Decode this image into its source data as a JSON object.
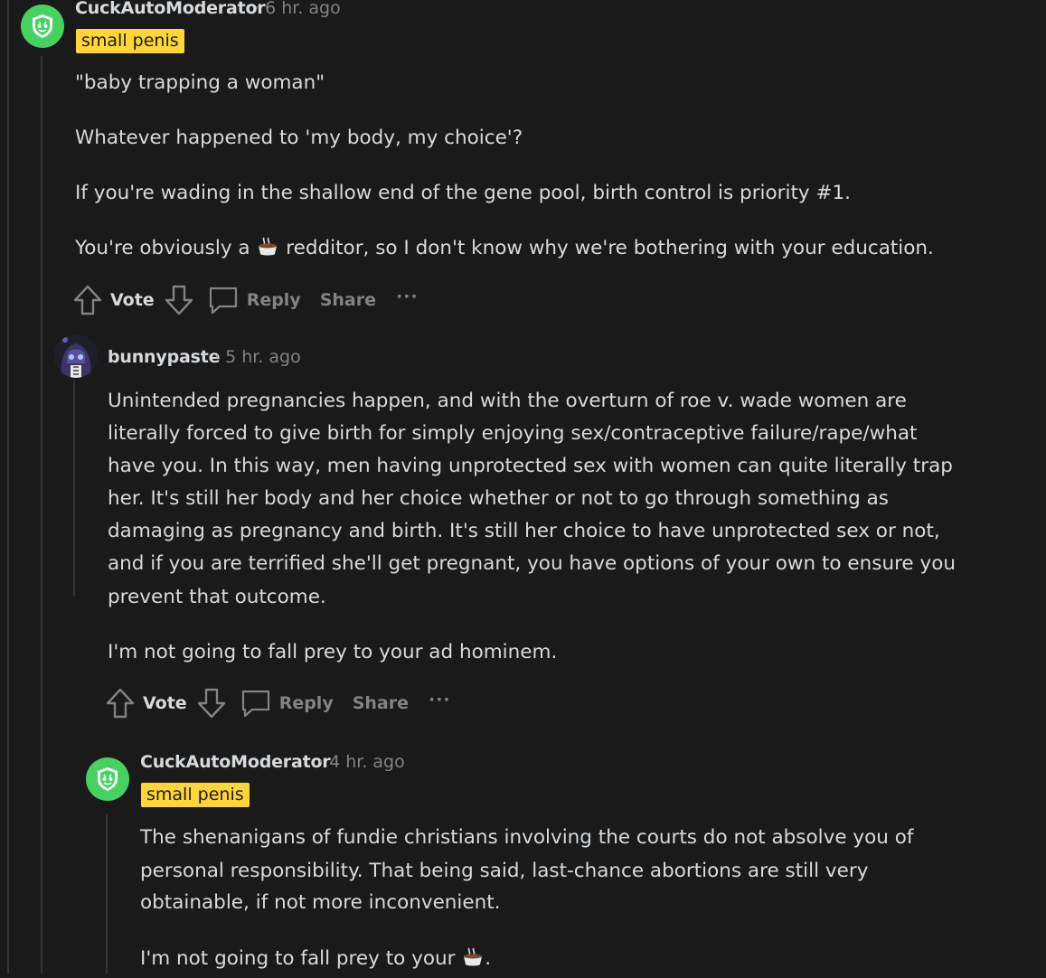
{
  "comments": [
    {
      "author": "CuckAutoModerator",
      "time": "· 6 hr. ago",
      "flair": "small penis",
      "paragraphs": [
        "\"baby trapping a woman\"",
        "Whatever happened to 'my body, my choice'?",
        "If you're wading in the shallow end of the gene pool, birth control is priority #1."
      ],
      "last_pre": "You're obviously a ",
      "last_post": " redditor, so I don't know why we're bothering with your education."
    },
    {
      "author": "bunnypaste",
      "time": "· 5 hr. ago",
      "paragraph_lines": [
        "Unintended pregnancies happen, and with the overturn of roe v. wade women are",
        "literally forced to give birth for simply enjoying sex/contraceptive failure/rape/what",
        "have you. In this way, men having unprotected sex with women can quite literally trap",
        "her. It's still her body and her choice whether or not to go through something as",
        "damaging as pregnancy and birth. It's still her choice to have unprotected sex or not,",
        "and if you are terrified she'll get pregnant, you have options of your own to ensure you",
        "prevent that outcome."
      ],
      "paragraph2": "I'm not going to fall prey to your ad hominem."
    },
    {
      "author": "CuckAutoModerator",
      "time": "· 4 hr. ago",
      "flair": "small penis",
      "paragraph_lines": [
        "The shenanigans of fundie christians involving the courts do not absolve you of",
        "personal responsibility. That being said, last-chance abortions are still very",
        "obtainable, if not more inconvenient."
      ],
      "last_pre": "I'm not going to fall prey to your ",
      "last_post": "."
    }
  ],
  "actions": {
    "vote": "Vote",
    "reply": "Reply",
    "share": "Share",
    "more": "···"
  },
  "icons": {
    "upvote": "upvote-arrow-icon",
    "downvote": "downvote-arrow-icon",
    "reply": "speech-bubble-icon",
    "more": "ellipsis-icon",
    "coffee": "coffee-cup-emoji",
    "mod_avatar": "shield-snoo-icon"
  },
  "colors": {
    "background": "#1a1a1b",
    "text": "#d7dadc",
    "muted": "#818384",
    "flair": "#ffd635",
    "mod_avatar": "#46d160"
  }
}
